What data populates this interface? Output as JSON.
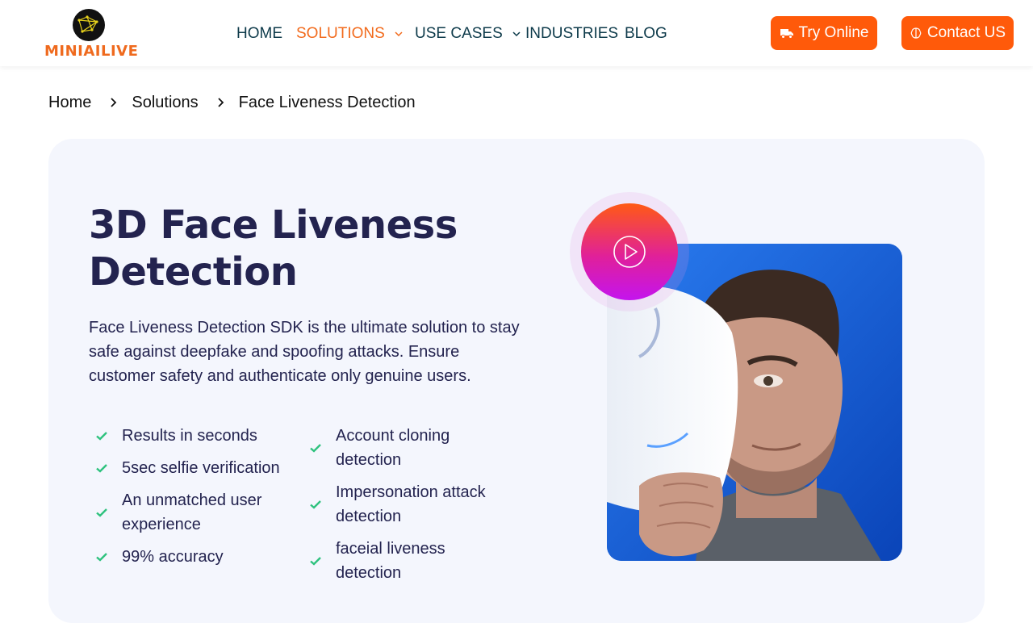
{
  "brand": {
    "name": "MINIAILIVE"
  },
  "nav": {
    "items": [
      {
        "label": "HOME",
        "active": false,
        "has_dropdown": false
      },
      {
        "label": "SOLUTIONS",
        "active": true,
        "has_dropdown": true
      },
      {
        "label": "USE CASES",
        "active": false,
        "has_dropdown": true
      },
      {
        "label": "INDUSTRIES",
        "active": false,
        "has_dropdown": false
      },
      {
        "label": "BLOG",
        "active": false,
        "has_dropdown": false
      }
    ],
    "try_online": "Try Online",
    "contact": "Contact US"
  },
  "breadcrumb": [
    "Home",
    "Solutions",
    "Face Liveness Detection"
  ],
  "hero": {
    "title": "3D Face Liveness Detection",
    "description": "Face Liveness Detection SDK is the ultimate solution to stay safe against deepfake and spoofing attacks. Ensure customer safety and authenticate only genuine users.",
    "features_left": [
      "Results in seconds",
      "5sec selfie verification",
      "An unmatched user experience",
      "99% accuracy"
    ],
    "features_right": [
      "Account cloning detection",
      "Impersonation attack detection",
      "faceial liveness detection"
    ]
  },
  "colors": {
    "accent": "#ff5a0a",
    "nav_text": "#0d3a4a",
    "heading": "#23234f",
    "check": "#2ec27e",
    "hero_bg": "#f4f6fd"
  }
}
